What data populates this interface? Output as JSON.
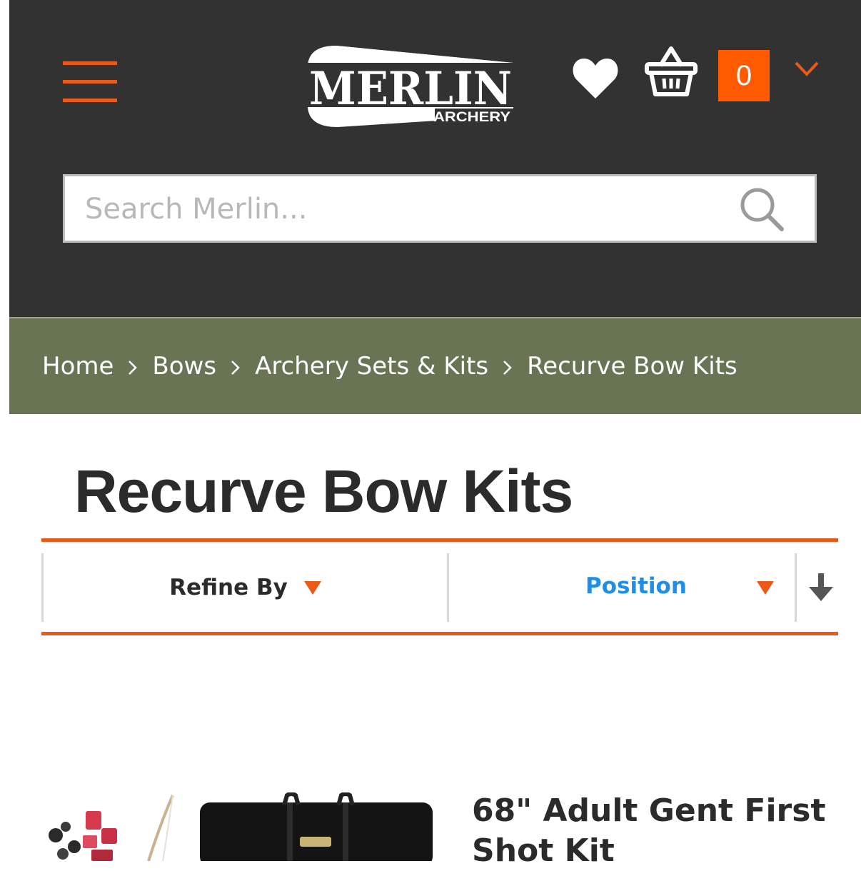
{
  "header": {
    "logo": {
      "main_text": "MERLIN",
      "sub_text": "ARCHERY"
    },
    "cart_count": "0",
    "search": {
      "placeholder": "Search Merlin..."
    },
    "icons": {
      "menu": "hamburger-menu-icon",
      "wishlist": "heart-icon",
      "basket": "basket-icon",
      "dropdown": "chevron-down-icon",
      "search": "search-icon"
    }
  },
  "breadcrumb": {
    "items": [
      {
        "label": "Home"
      },
      {
        "label": "Bows"
      },
      {
        "label": "Archery Sets & Kits"
      },
      {
        "label": "Recurve Bow Kits"
      }
    ]
  },
  "page": {
    "title": "Recurve Bow Kits"
  },
  "toolbar": {
    "refine_label": "Refine By",
    "sort_selected": "Position",
    "sort_direction_icon": "arrow-down-icon"
  },
  "products": [
    {
      "title": "68\" Adult Gent First Shot Kit"
    }
  ],
  "colors": {
    "header_bg": "#323232",
    "accent_orange": "#ec5a18",
    "cart_badge": "#ff5a00",
    "breadcrumb_bg": "#687453",
    "link_blue": "#1f8ee8",
    "text_dark": "#2b2b2b"
  }
}
